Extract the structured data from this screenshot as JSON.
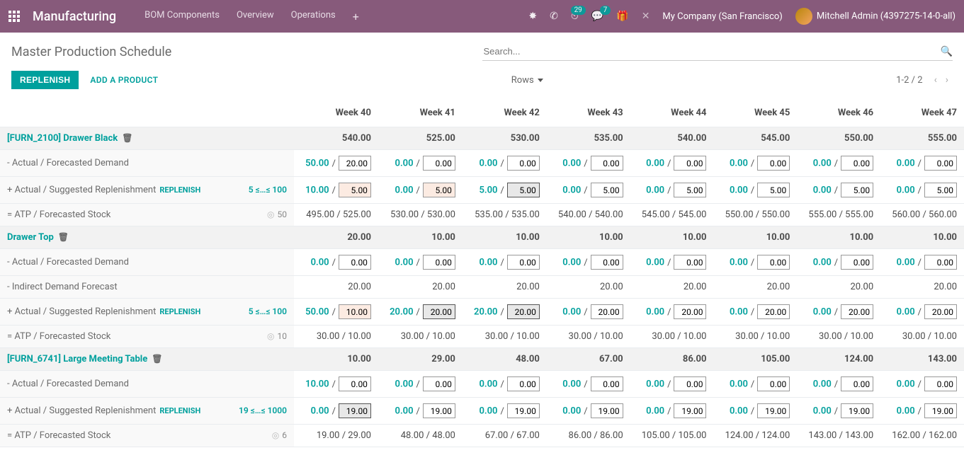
{
  "header": {
    "brand": "Manufacturing",
    "menu": [
      "BOM Components",
      "Overview",
      "Operations"
    ],
    "activities_badge": "29",
    "discuss_badge": "7",
    "company": "My Company (San Francisco)",
    "user": "Mitchell Admin (4397275-14-0-all)"
  },
  "page": {
    "title": "Master Production Schedule",
    "search_placeholder": "Search...",
    "replenish_btn": "REPLENISH",
    "add_product_btn": "ADD A PRODUCT",
    "rows_label": "Rows",
    "pager": "1-2 / 2"
  },
  "weeks": [
    "Week 40",
    "Week 41",
    "Week 42",
    "Week 43",
    "Week 44",
    "Week 45",
    "Week 46",
    "Week 47"
  ],
  "labels": {
    "demand": "- Actual / Forecasted Demand",
    "replen": "+ Actual / Suggested Replenishment",
    "replen_link": "REPLENISH",
    "atp": "= ATP / Forecasted Stock",
    "indirect": "- Indirect Demand Forecast"
  },
  "products": [
    {
      "name": "[FURN_2100] Drawer Black",
      "min_max": "5 ≤…≤ 100",
      "target": "50",
      "starting": [
        "540.00",
        "525.00",
        "530.00",
        "535.00",
        "540.00",
        "545.00",
        "550.00",
        "555.00"
      ],
      "demand_actual": [
        "50.00",
        "0.00",
        "0.00",
        "0.00",
        "0.00",
        "0.00",
        "0.00",
        "0.00"
      ],
      "demand_forecast": [
        "20.00",
        "0.00",
        "0.00",
        "0.00",
        "0.00",
        "0.00",
        "0.00",
        "0.00"
      ],
      "replen_actual": [
        "10.00",
        "0.00",
        "5.00",
        "0.00",
        "0.00",
        "0.00",
        "0.00",
        "0.00"
      ],
      "replen_suggest": [
        "5.00",
        "5.00",
        "5.00",
        "5.00",
        "5.00",
        "5.00",
        "5.00",
        "5.00"
      ],
      "replen_style": [
        "peach",
        "peach",
        "grey",
        "",
        "",
        "",
        "",
        ""
      ],
      "atp": [
        "495.00 / 525.00",
        "530.00 / 530.00",
        "535.00 / 535.00",
        "540.00 / 540.00",
        "545.00 / 545.00",
        "550.00 / 550.00",
        "555.00 / 555.00",
        "560.00 / 560.00"
      ]
    },
    {
      "name": "Drawer Top",
      "min_max": "5 ≤…≤ 100",
      "target": "10",
      "starting": [
        "20.00",
        "10.00",
        "10.00",
        "10.00",
        "10.00",
        "10.00",
        "10.00",
        "10.00"
      ],
      "demand_actual": [
        "0.00",
        "0.00",
        "0.00",
        "0.00",
        "0.00",
        "0.00",
        "0.00",
        "0.00"
      ],
      "demand_forecast": [
        "0.00",
        "0.00",
        "0.00",
        "0.00",
        "0.00",
        "0.00",
        "0.00",
        "0.00"
      ],
      "has_indirect": true,
      "indirect": [
        "20.00",
        "20.00",
        "20.00",
        "20.00",
        "20.00",
        "20.00",
        "20.00",
        "20.00"
      ],
      "replen_actual": [
        "50.00",
        "20.00",
        "20.00",
        "0.00",
        "0.00",
        "0.00",
        "0.00",
        "0.00"
      ],
      "replen_suggest": [
        "10.00",
        "20.00",
        "20.00",
        "20.00",
        "20.00",
        "20.00",
        "20.00",
        "20.00"
      ],
      "replen_style": [
        "peach",
        "grey",
        "grey",
        "",
        "",
        "",
        "",
        ""
      ],
      "atp": [
        "30.00 / 10.00",
        "30.00 / 10.00",
        "30.00 / 10.00",
        "30.00 / 10.00",
        "30.00 / 10.00",
        "30.00 / 10.00",
        "30.00 / 10.00",
        "30.00 / 10.00"
      ]
    },
    {
      "name": "[FURN_6741] Large Meeting Table",
      "min_max": "19 ≤…≤ 1000",
      "target": "6",
      "starting": [
        "10.00",
        "29.00",
        "48.00",
        "67.00",
        "86.00",
        "105.00",
        "124.00",
        "143.00"
      ],
      "demand_actual": [
        "10.00",
        "0.00",
        "0.00",
        "0.00",
        "0.00",
        "0.00",
        "0.00",
        "0.00"
      ],
      "demand_forecast": [
        "0.00",
        "0.00",
        "0.00",
        "0.00",
        "0.00",
        "0.00",
        "0.00",
        "0.00"
      ],
      "replen_actual": [
        "0.00",
        "0.00",
        "0.00",
        "0.00",
        "0.00",
        "0.00",
        "0.00",
        "0.00"
      ],
      "replen_suggest": [
        "19.00",
        "19.00",
        "19.00",
        "19.00",
        "19.00",
        "19.00",
        "19.00",
        "19.00"
      ],
      "replen_style": [
        "grey",
        "",
        "",
        "",
        "",
        "",
        "",
        ""
      ],
      "atp": [
        "19.00 / 29.00",
        "48.00 / 48.00",
        "67.00 / 67.00",
        "86.00 / 86.00",
        "105.00 / 105.00",
        "124.00 / 124.00",
        "143.00 / 143.00",
        "162.00 / 162.00"
      ]
    }
  ]
}
